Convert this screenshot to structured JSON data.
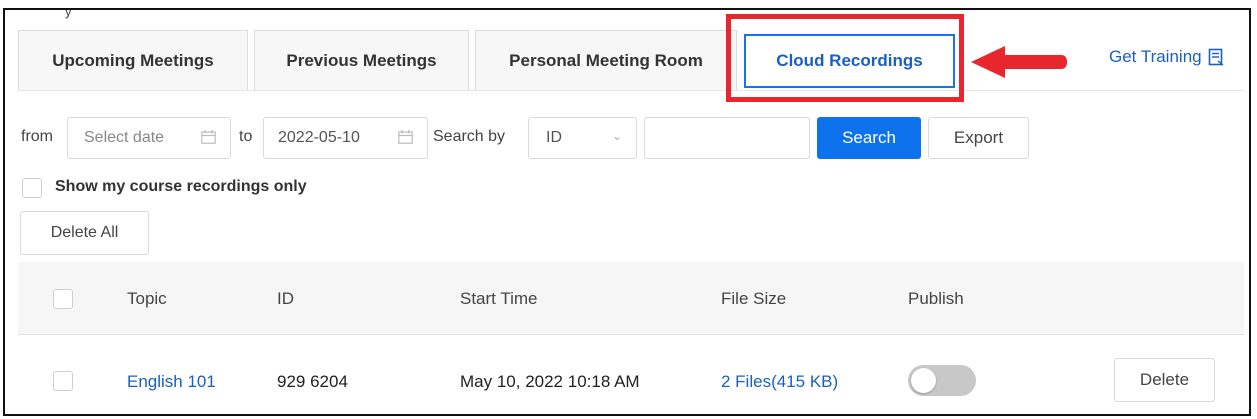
{
  "header_partial_text": "y",
  "tabs": [
    {
      "label": "Upcoming Meetings",
      "active": false
    },
    {
      "label": "Previous Meetings",
      "active": false
    },
    {
      "label": "Personal Meeting Room",
      "active": false
    },
    {
      "label": "Cloud Recordings",
      "active": true
    }
  ],
  "get_training": {
    "label": "Get Training",
    "icon": "book-icon"
  },
  "annotation": {
    "highlight_color": "#e8262d",
    "arrow_color": "#e8262d"
  },
  "filters": {
    "from_label": "from",
    "from_placeholder": "Select date",
    "to_label": "to",
    "to_value": "2022-05-10",
    "search_by_label": "Search by",
    "search_by_value": "ID",
    "search_query": "",
    "search_button": "Search",
    "export_button": "Export"
  },
  "course_only": {
    "label": "Show my course recordings only",
    "checked": false
  },
  "delete_all_button": "Delete All",
  "table": {
    "columns": [
      "Topic",
      "ID",
      "Start Time",
      "File Size",
      "Publish"
    ],
    "rows": [
      {
        "topic": "English 101",
        "id": "929 6204",
        "start_time": "May 10, 2022 10:18 AM",
        "file_size": "2 Files(415 KB)",
        "publish": false,
        "delete_label": "Delete"
      }
    ]
  },
  "colors": {
    "accent": "#0e72ed",
    "link": "#1a5fc2"
  }
}
